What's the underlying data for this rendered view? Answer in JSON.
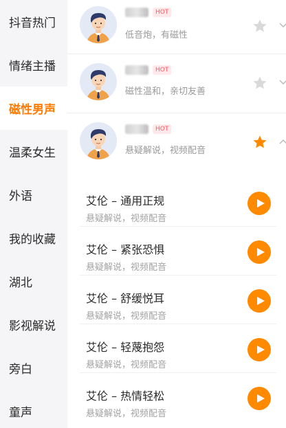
{
  "colors": {
    "accent": "#ff8a00",
    "active_text": "#ff7a00",
    "hot_text": "#ff5a63",
    "hot_bg": "#ffe9ea",
    "sidebar_bg": "#f5f5f7"
  },
  "sidebar": {
    "items": [
      {
        "label": "抖音热门"
      },
      {
        "label": "情绪主播"
      },
      {
        "label": "磁性男声",
        "active": true
      },
      {
        "label": "温柔女生"
      },
      {
        "label": "外语"
      },
      {
        "label": "我的收藏"
      },
      {
        "label": "湖北"
      },
      {
        "label": "影视解说"
      },
      {
        "label": "旁白"
      },
      {
        "label": "童声"
      }
    ]
  },
  "voices": [
    {
      "badge": "HOT",
      "desc": "低音炮，有磁性",
      "favorited": false,
      "icon": "star-outline-icon"
    },
    {
      "badge": "HOT",
      "desc": "磁性温和，亲切友善",
      "favorited": false,
      "icon": "star-outline-icon"
    },
    {
      "badge": "HOT",
      "desc": "悬疑解说，视频配音",
      "favorited": true,
      "icon": "star-filled-icon"
    }
  ],
  "styles": [
    {
      "title": "艾伦 – 通用正规",
      "desc": "悬疑解说，视频配音"
    },
    {
      "title": "艾伦 – 紧张恐惧",
      "desc": "悬疑解说，视频配音"
    },
    {
      "title": "艾伦 – 舒缓悦耳",
      "desc": "悬疑解说，视频配音"
    },
    {
      "title": "艾伦 – 轻蔑抱怨",
      "desc": "悬疑解说，视频配音"
    },
    {
      "title": "艾伦 – 热情轻松",
      "desc": "悬疑解说，视频配音"
    }
  ]
}
